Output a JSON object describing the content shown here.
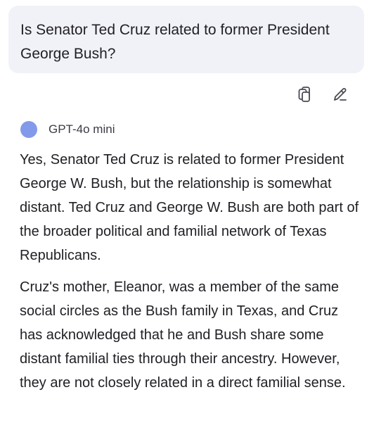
{
  "user_message": {
    "text": "Is Senator Ted Cruz related to former President George Bush?"
  },
  "actions": {
    "copy_icon": "copy-icon",
    "edit_icon": "edit-pencil-icon"
  },
  "model": {
    "name": "GPT-4o mini",
    "dot_color": "#829ae9"
  },
  "response": {
    "paragraphs": [
      "Yes, Senator Ted Cruz is related to former President George W. Bush, but the relationship is somewhat distant. Ted Cruz and George W. Bush are both part of the broader political and familial network of Texas Republicans.",
      "Cruz's mother, Eleanor, was a member of the same social circles as the Bush family in Texas, and Cruz has acknowledged that he and Bush share some distant familial ties through their ancestry. However, they are not closely related in a direct familial sense."
    ]
  }
}
